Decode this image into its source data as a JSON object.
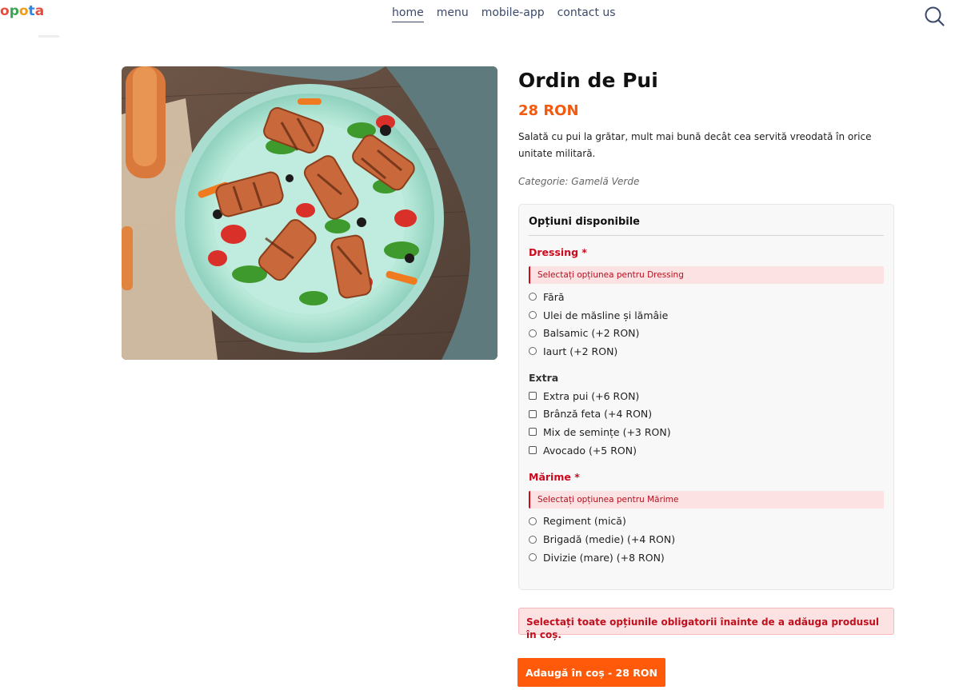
{
  "header": {
    "logo_letters": [
      "o",
      "p",
      "o",
      "t",
      "a"
    ],
    "nav": [
      {
        "label": "home",
        "active": true
      },
      {
        "label": "menu",
        "active": false
      },
      {
        "label": "mobile-app",
        "active": false
      },
      {
        "label": "contact us",
        "active": false
      }
    ],
    "search_icon": "search-icon"
  },
  "product": {
    "title": "Ordin de Pui",
    "price": "28 RON",
    "description": "Salată cu pui la grătar, mult mai bună decât cea servită vreodată în orice unitate militară.",
    "category": "Categorie: Gamelă Verde",
    "image": "grilled-halloumi-salad-plate"
  },
  "options": {
    "title": "Opțiuni disponibile",
    "dressing": {
      "label": "Dressing",
      "required_mark": "*",
      "alert": "Selectați opțiunea pentru Dressing",
      "choices": [
        "Fără",
        "Ulei de măsline și lămâie",
        "Balsamic (+2 RON)",
        "Iaurt (+2 RON)"
      ]
    },
    "extra": {
      "label": "Extra",
      "choices": [
        "Extra pui (+6 RON)",
        "Brânză feta (+4 RON)",
        "Mix de semințe (+3 RON)",
        "Avocado (+5 RON)"
      ]
    },
    "size": {
      "label": "Mărime",
      "required_mark": "*",
      "alert": "Selectați opțiunea pentru Mărime",
      "choices": [
        "Regiment (mică)",
        "Brigadă (medie) (+4 RON)",
        "Divizie (mare) (+8 RON)"
      ]
    }
  },
  "alert_main": "Selectați toate opțiunile obligatorii înainte de a adăuga produsul în coș.",
  "add_button": "Adaugă în coș - 28 RON",
  "colors": {
    "accent": "#ff5a0a",
    "price": "#f15a0f",
    "required": "#cc0a1e",
    "nav": "#3b4a6b"
  }
}
